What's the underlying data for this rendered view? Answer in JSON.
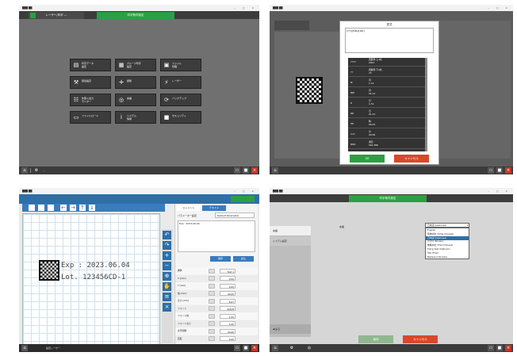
{
  "panel1": {
    "app_title": "███ ██",
    "header_tab_left": "レーザー/印字 ---",
    "header_tab_right": "印字条件設定",
    "buttons": [
      {
        "icon": "document-icon",
        "glyph": "▤",
        "line1": "印字データ",
        "line2": "設定"
      },
      {
        "icon": "group-icon",
        "glyph": "▦",
        "line1": "グループ印字",
        "line2": "設定"
      },
      {
        "icon": "file-icon",
        "glyph": "▣",
        "line1": "ファイル",
        "line2": "管理"
      },
      {
        "icon": "wrench-icon",
        "glyph": "⚒",
        "line1": "環境設定",
        "line2": ""
      },
      {
        "icon": "crosshair-icon",
        "glyph": "✛",
        "line1": "調整",
        "line2": ""
      },
      {
        "icon": "laser-icon",
        "glyph": "⚡",
        "line1": "レーザー",
        "line2": ""
      },
      {
        "icon": "sitemap-icon",
        "glyph": "☷",
        "line1": "外部入出力",
        "line2": "モニター"
      },
      {
        "icon": "globe-icon",
        "glyph": "◎",
        "line1": "言語",
        "line2": ""
      },
      {
        "icon": "refresh-icon",
        "glyph": "⟳",
        "line1": "バックアップ",
        "line2": ""
      },
      {
        "icon": "file-manager-icon",
        "glyph": "▭",
        "line1": "ファイルロード",
        "line2": ""
      },
      {
        "icon": "info-icon",
        "glyph": "i",
        "line1": "システム",
        "line2": "情報"
      },
      {
        "icon": "lock-icon",
        "glyph": "■",
        "line1": "セキュリティ",
        "line2": ""
      }
    ],
    "status_text": "---"
  },
  "panel2": {
    "dialog_title": "書式",
    "format_value": "[YY]/[MM]/[DD]",
    "rows": [
      {
        "code": "YYYY",
        "line1": "西暦年·上4桁",
        "line2": "2023"
      },
      {
        "code": "YY",
        "line1": "西暦年·下2桁",
        "line2": "23"
      },
      {
        "code": "M",
        "line1": "月",
        "line2": "1-12"
      },
      {
        "code": "MM",
        "line1": "月",
        "line2": "01-12"
      },
      {
        "code": "D",
        "line1": "日",
        "line2": "1-31"
      },
      {
        "code": "DD",
        "line1": "日",
        "line2": "01-31"
      },
      {
        "code": "HH",
        "line1": "時",
        "line2": "00-23"
      },
      {
        "code": "mm",
        "line1": "分",
        "line2": "00-59"
      },
      {
        "code": "DDD",
        "line1": "通日",
        "line2": "001-366"
      }
    ],
    "ok_label": "OK",
    "cancel_label": "キャンセル"
  },
  "panel3": {
    "tab_element": "エレメント",
    "tab_other": "テキスト",
    "param_label": "パラメーター設定",
    "param_value": "Default Parameter",
    "text_preview": "Exp : 2023.06.04",
    "btn_save": "保存",
    "btn_load": "読込",
    "canvas_line1": "Exp : 2023.06.04",
    "canvas_line2": "Lot. 123456CD-1",
    "props": [
      {
        "k": "書体",
        "v": "Text 1"
      },
      {
        "k": "X [mm]",
        "v": "0.00"
      },
      {
        "k": "Y [mm]",
        "v": "0.00"
      },
      {
        "k": "幅 [mm]",
        "v": "40.00"
      },
      {
        "k": "高さ [mm]",
        "v": "6.67"
      },
      {
        "k": "フォント",
        "v": "OCR-B"
      },
      {
        "k": "フォント幅",
        "v": "1.00"
      },
      {
        "k": "フォント高さ",
        "v": "2.00"
      },
      {
        "k": "文字間隔",
        "v": "20.00"
      },
      {
        "k": "回転",
        "v": "0.00"
      }
    ],
    "status_text": "設定レーザー"
  },
  "panel4": {
    "header_title": "印字条件設定",
    "menu_item_selected": "言語",
    "menu_item_2": "システム設定",
    "back_label": "戻る",
    "field_label": "言語",
    "select_value": "日本語 (Japanese)",
    "options": [
      "English",
      "简体中文 (Simp.Chinese)",
      "日本語 (Japanese)",
      "한국어 (Korean)",
      "繁體中文 (Trad.Chinese)",
      "Tiếng Việt (Vietnam)",
      "ไทย (Thai)",
      "Bahasa Indonesia"
    ],
    "ok_label": "保存",
    "cancel_label": "キャンセル"
  }
}
